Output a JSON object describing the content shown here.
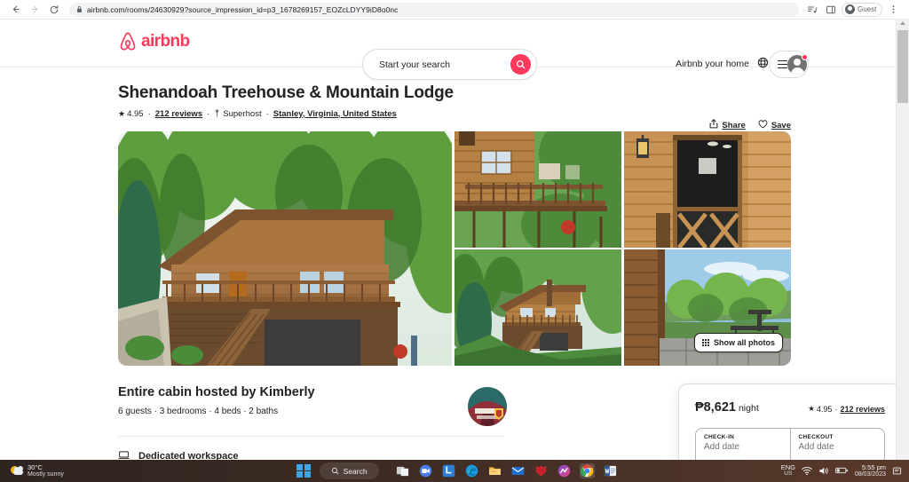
{
  "browser": {
    "back_icon": "back-arrow-icon",
    "forward_icon": "forward-arrow-icon",
    "reload_icon": "reload-icon",
    "lock_icon": "lock-icon",
    "url": "airbnb.com/rooms/24630929?source_impression_id=p3_1678269157_EOZcLDYY9iD8o0nc",
    "split_icon": "reading-list-icon",
    "sidepanel_icon": "side-panel-icon",
    "profile_label": "Guest",
    "menu_icon": "three-dot-menu-icon"
  },
  "site_header": {
    "logo_text": "airbnb",
    "search_placeholder": "Start your search",
    "search_icon": "search-icon",
    "host_link": "Airbnb your home",
    "globe_icon": "globe-icon",
    "menu_icon": "hamburger-icon",
    "avatar_icon": "user-avatar-icon"
  },
  "listing": {
    "title": "Shenandoah Treehouse & Mountain Lodge",
    "rating": "4.95",
    "reviews": "212 reviews",
    "superhost": "Superhost",
    "location": "Stanley, Virginia, United States",
    "share_label": "Share",
    "save_label": "Save",
    "share_icon": "share-icon",
    "save_icon": "heart-icon",
    "show_all_photos": "Show all photos",
    "grid_icon": "grid-icon",
    "photos": [
      "cabin-exterior-front",
      "cabin-deck-railing",
      "cabin-screen-door",
      "cabin-hillside-view",
      "cabin-patio-valley-view"
    ]
  },
  "host_section": {
    "title": "Entire cabin hosted by Kimberly",
    "details": "6 guests · 3 bedrooms · 4 beds · 2 baths",
    "avatar_icon": "host-avatar-icon",
    "amenity": "Dedicated workspace",
    "amenity_icon": "workspace-icon"
  },
  "booking": {
    "price": "₱8,621",
    "price_unit": "night",
    "star_icon": "star-icon",
    "rating": "4.95",
    "reviews": "212 reviews",
    "checkin_label": "CHECK-IN",
    "checkin_value": "Add date",
    "checkout_label": "CHECKOUT",
    "checkout_value": "Add date"
  },
  "taskbar": {
    "weather_temp": "30°C",
    "weather_desc": "Mostly sunny",
    "weather_icon": "partly-cloudy-icon",
    "start_icon": "windows-start-icon",
    "search_label": "Search",
    "search_icon": "search-icon",
    "apps": [
      "task-view-icon",
      "zoom-icon",
      "linkedin-icon",
      "edge-icon",
      "file-explorer-icon",
      "mail-icon",
      "mcafee-icon",
      "copilot-icon",
      "chrome-icon",
      "word-icon"
    ],
    "lang_primary": "ENG",
    "lang_secondary": "US",
    "wifi_icon": "wifi-icon",
    "volume_icon": "volume-icon",
    "battery_icon": "battery-icon",
    "time": "5:55 pm",
    "date": "08/03/2023",
    "notification_icon": "notification-icon"
  },
  "colors": {
    "brand": "#FF385C",
    "text": "#222222",
    "muted": "#717171"
  }
}
